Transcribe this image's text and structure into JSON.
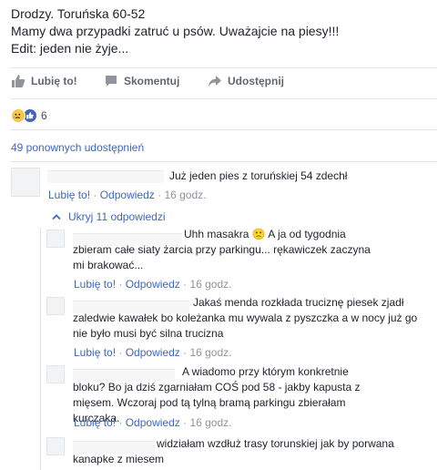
{
  "post": {
    "lines": [
      "Drodzy. Toruńska 60-52",
      "Mamy dwa przypadki zatruć u psów. Uważajcie na piesy!!!",
      "Edit: jeden nie żyje..."
    ]
  },
  "actions": {
    "like": "Lubię to!",
    "comment": "Skomentuj",
    "share": "Udostępnij"
  },
  "reactions": {
    "count": "6"
  },
  "shares": "49 ponownych udostępnień",
  "meta": {
    "like": "Lubię to!",
    "reply": "Odpowiedz",
    "sep": " · "
  },
  "top_comment": {
    "text": "Już jeden pies z toruńskiej 54 zdechł",
    "time": "16 godz."
  },
  "toggle": "Ukryj 11 odpowiedzi",
  "replies": [
    {
      "text": "Uhh masakra 🙁 A ja od tygodnia zbieram całe siaty żarcia przy parkingu... rękawiczek zaczyna mi brakować...",
      "time": "16 godz."
    },
    {
      "text": "Jakaś menda rozkłada truciznę piesek zjadł zaledwie kawałek bo koleżanka mu wywala z pyszczka a w nocy już go nie było musi być silna trucizna",
      "time": "16 godz."
    },
    {
      "text": "A wiadomo przy którym konkretnie bloku? Bo ja dziś zgarniałam COŚ pod 58 - jakby kapusta z mięsem. Wczoraj pod tą tylną bramą parkingu zbierałam kurczaka.",
      "time": "16 godz."
    },
    {
      "text": "widziałam wzdłuż trasy torunskiej jak by porwana kanapke z miesem"
    }
  ],
  "colors": {
    "link": "#4267b2",
    "muted": "#90949c",
    "action": "#606770",
    "text": "#1d2129"
  }
}
